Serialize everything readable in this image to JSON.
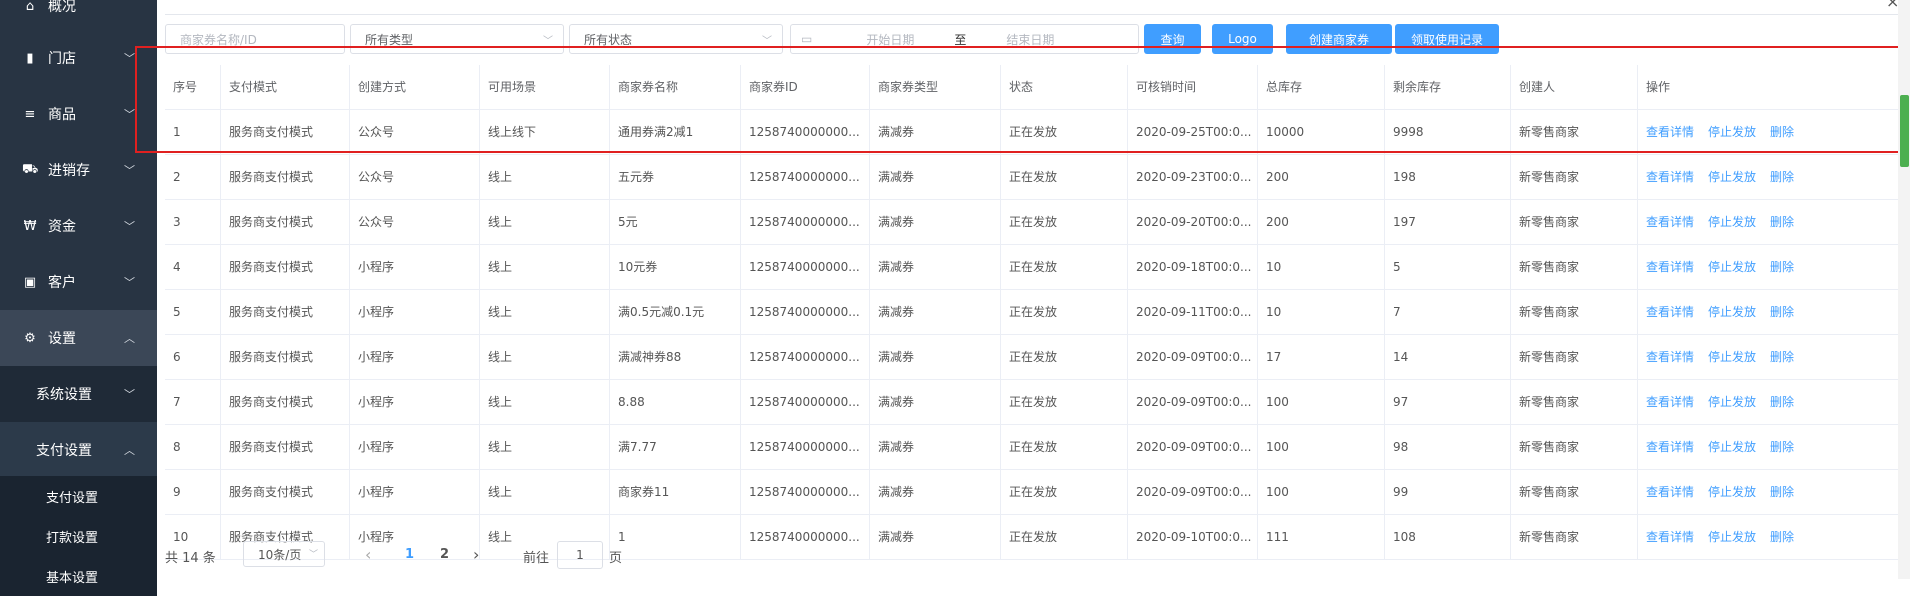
{
  "sidebar": {
    "items": [
      {
        "icon": "home-icon",
        "glyph": "⌂",
        "label": "概况"
      },
      {
        "icon": "store-icon",
        "glyph": "▮",
        "label": "门店"
      },
      {
        "icon": "list-icon",
        "glyph": "≡",
        "label": "商品"
      },
      {
        "icon": "truck-icon",
        "glyph": "⛟",
        "label": "进销存"
      },
      {
        "icon": "won-icon",
        "glyph": "₩",
        "label": "资金"
      },
      {
        "icon": "idcard-icon",
        "glyph": "▣",
        "label": "客户"
      },
      {
        "icon": "gear-icon",
        "glyph": "⚙",
        "label": "设置"
      }
    ],
    "sub": [
      {
        "label": "系统设置"
      },
      {
        "label": "支付设置"
      }
    ],
    "leaves": [
      {
        "label": "支付设置"
      },
      {
        "label": "打款设置"
      },
      {
        "label": "基本设置"
      }
    ]
  },
  "filters": {
    "name_placeholder": "商家券名称/ID",
    "type_value": "所有类型",
    "status_value": "所有状态",
    "start_placeholder": "开始日期",
    "to_label": "至",
    "end_placeholder": "结束日期"
  },
  "buttons": {
    "query": "查询",
    "logo": "Logo",
    "create": "创建商家券",
    "records": "领取使用记录"
  },
  "table": {
    "headers": [
      "序号",
      "支付模式",
      "创建方式",
      "可用场景",
      "商家券名称",
      "商家券ID",
      "商家券类型",
      "状态",
      "可核销时间",
      "总库存",
      "剩余库存",
      "创建人",
      "操作"
    ],
    "actions": [
      "查看详情",
      "停止发放",
      "删除"
    ],
    "rows": [
      [
        "1",
        "服务商支付模式",
        "公众号",
        "线上线下",
        "通用券满2减1",
        "1258740000000...",
        "满减券",
        "正在发放",
        "2020-09-25T00:0...",
        "10000",
        "9998",
        "新零售商家"
      ],
      [
        "2",
        "服务商支付模式",
        "公众号",
        "线上",
        "五元券",
        "1258740000000...",
        "满减券",
        "正在发放",
        "2020-09-23T00:0...",
        "200",
        "198",
        "新零售商家"
      ],
      [
        "3",
        "服务商支付模式",
        "公众号",
        "线上",
        "5元",
        "1258740000000...",
        "满减券",
        "正在发放",
        "2020-09-20T00:0...",
        "200",
        "197",
        "新零售商家"
      ],
      [
        "4",
        "服务商支付模式",
        "小程序",
        "线上",
        "10元券",
        "1258740000000...",
        "满减券",
        "正在发放",
        "2020-09-18T00:0...",
        "10",
        "5",
        "新零售商家"
      ],
      [
        "5",
        "服务商支付模式",
        "小程序",
        "线上",
        "满0.5元减0.1元",
        "1258740000000...",
        "满减券",
        "正在发放",
        "2020-09-11T00:0...",
        "10",
        "7",
        "新零售商家"
      ],
      [
        "6",
        "服务商支付模式",
        "小程序",
        "线上",
        "满减神券88",
        "1258740000000...",
        "满减券",
        "正在发放",
        "2020-09-09T00:0...",
        "17",
        "14",
        "新零售商家"
      ],
      [
        "7",
        "服务商支付模式",
        "小程序",
        "线上",
        "8.88",
        "1258740000000...",
        "满减券",
        "正在发放",
        "2020-09-09T00:0...",
        "100",
        "97",
        "新零售商家"
      ],
      [
        "8",
        "服务商支付模式",
        "小程序",
        "线上",
        "满7.77",
        "1258740000000...",
        "满减券",
        "正在发放",
        "2020-09-09T00:0...",
        "100",
        "98",
        "新零售商家"
      ],
      [
        "9",
        "服务商支付模式",
        "小程序",
        "线上",
        "商家券11",
        "1258740000000...",
        "满减券",
        "正在发放",
        "2020-09-09T00:0...",
        "100",
        "99",
        "新零售商家"
      ],
      [
        "10",
        "服务商支付模式",
        "小程序",
        "线上",
        "1",
        "1258740000000...",
        "满减券",
        "正在发放",
        "2020-09-10T00:0...",
        "111",
        "108",
        "新零售商家"
      ]
    ]
  },
  "pager": {
    "total": "共 14 条",
    "page_size": "10条/页",
    "prev": "‹",
    "pages": [
      "1",
      "2"
    ],
    "next": "›",
    "goto_label": "前往",
    "goto_value": "1",
    "page_suffix": "页"
  },
  "window": {
    "close_glyph": "×"
  }
}
